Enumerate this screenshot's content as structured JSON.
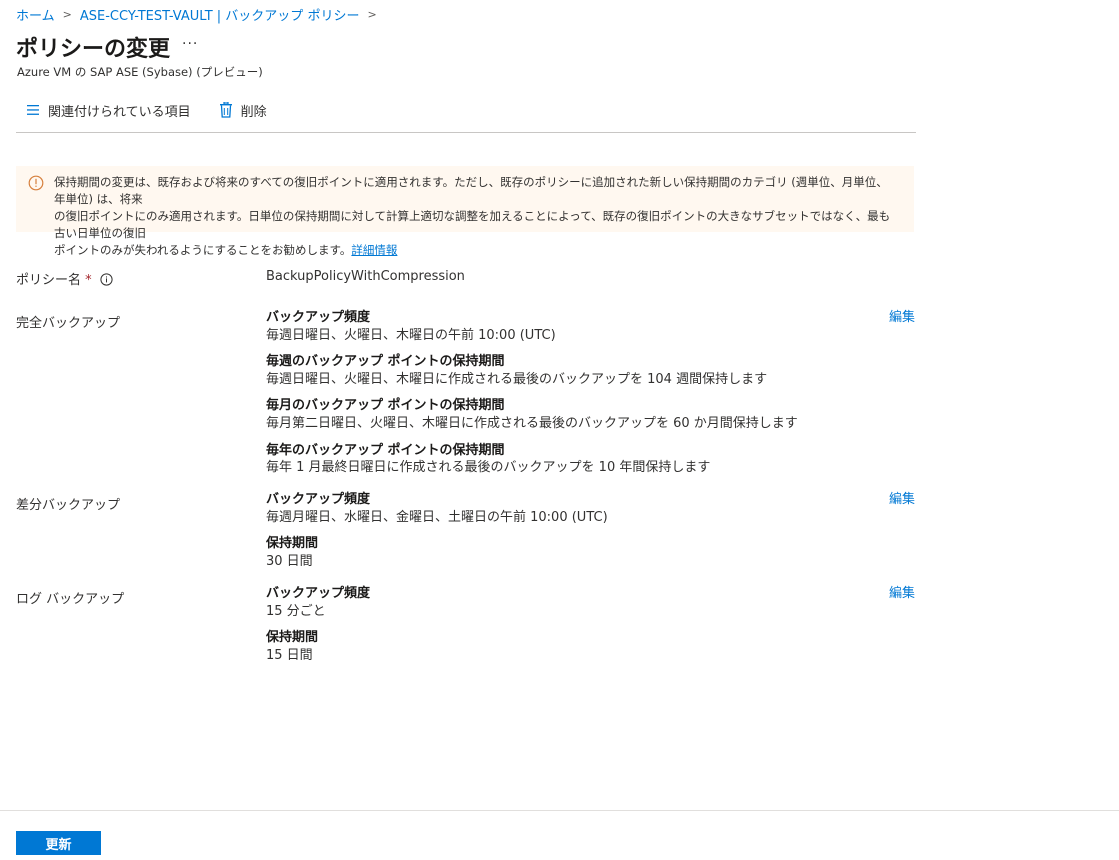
{
  "breadcrumb": {
    "items": [
      "ホーム",
      "ASE-CCY-TEST-VAULT | バックアップ ポリシー"
    ],
    "separator": ">"
  },
  "header": {
    "title": "ポリシーの変更",
    "more": "···",
    "subtitle": "Azure VM の SAP ASE (Sybase) (プレビュー)"
  },
  "toolbar": {
    "associated_items": "関連付けられている項目",
    "delete": "削除"
  },
  "banner": {
    "line1": "保持期間の変更は、既存および将来のすべての復旧ポイントに適用されます。ただし、既存のポリシーに追加された新しい保持期間のカテゴリ (週単位、月単位、年単位) は、将来",
    "line2": "の復旧ポイントにのみ適用されます。日単位の保持期間に対して計算上適切な調整を加えることによって、既存の復旧ポイントの大きなサブセットではなく、最も古い日単位の復旧",
    "line3": "ポイントのみが失われるようにすることをお勧めします。",
    "link": "詳細情報"
  },
  "policy_name": {
    "label": "ポリシー名",
    "required_mark": "*",
    "value": "BackupPolicyWithCompression"
  },
  "full_backup": {
    "label": "完全バックアップ",
    "edit": "編集",
    "frequency_title": "バックアップ頻度",
    "frequency_value": "毎週日曜日、火曜日、木曜日の午前 10:00 (UTC)",
    "weekly_title": "毎週のバックアップ ポイントの保持期間",
    "weekly_value": "毎週日曜日、火曜日、木曜日に作成される最後のバックアップを 104 週間保持します",
    "monthly_title": "毎月のバックアップ ポイントの保持期間",
    "monthly_value": "毎月第二日曜日、火曜日、木曜日に作成される最後のバックアップを 60 か月間保持します",
    "yearly_title": "毎年のバックアップ ポイントの保持期間",
    "yearly_value": "毎年 1 月最終日曜日に作成される最後のバックアップを 10 年間保持します"
  },
  "diff_backup": {
    "label": "差分バックアップ",
    "edit": "編集",
    "frequency_title": "バックアップ頻度",
    "frequency_value": "毎週月曜日、水曜日、金曜日、土曜日の午前 10:00 (UTC)",
    "retention_title": "保持期間",
    "retention_value": "30 日間"
  },
  "log_backup": {
    "label": "ログ バックアップ",
    "edit": "編集",
    "frequency_title": "バックアップ頻度",
    "frequency_value": "15 分ごと",
    "retention_title": "保持期間",
    "retention_value": "15 日間"
  },
  "footer": {
    "update": "更新"
  },
  "colors": {
    "accent": "#0078d4",
    "banner_bg": "#fff8f0",
    "warning": "#d67f3c"
  }
}
